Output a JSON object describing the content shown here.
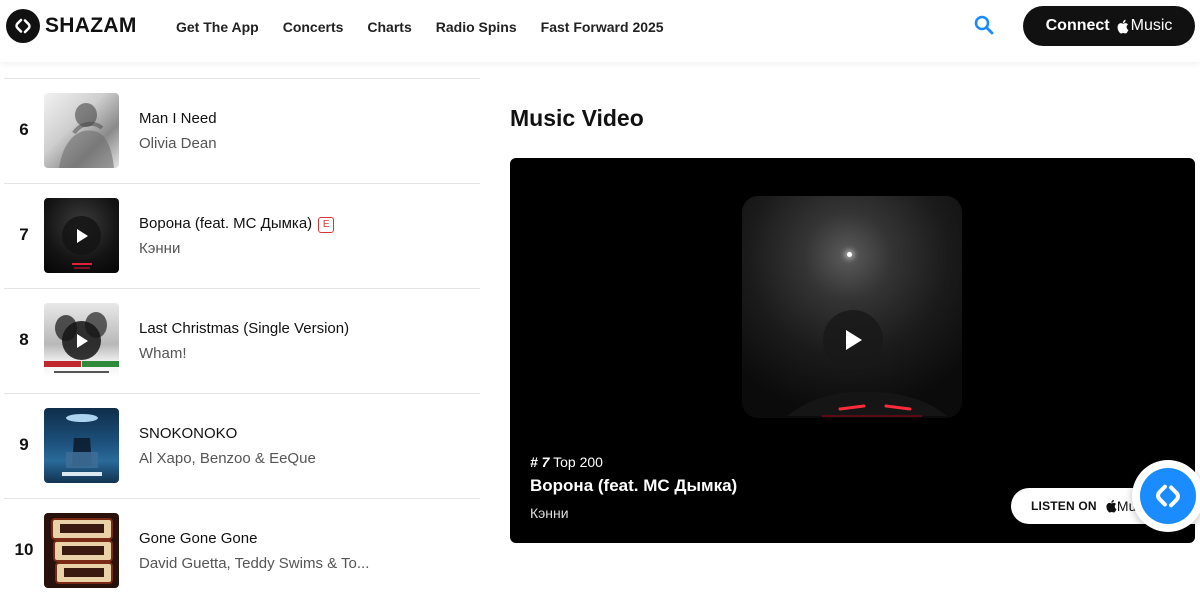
{
  "header": {
    "logo_text": "SHAZAM",
    "nav": [
      "Get The App",
      "Concerts",
      "Charts",
      "Radio Spins",
      "Fast Forward 2025"
    ],
    "connect_label": "Connect",
    "apple_music_label": "Music"
  },
  "chart_list": [
    {
      "rank": "6",
      "title": "Man I Need",
      "artist": "Olivia Dean",
      "explicit": false
    },
    {
      "rank": "7",
      "title": "Ворона (feat. MC Дымка)",
      "artist": "Кэнни",
      "explicit": true,
      "explicit_label": "E"
    },
    {
      "rank": "8",
      "title": "Last Christmas (Single Version)",
      "artist": "Wham!",
      "explicit": false
    },
    {
      "rank": "9",
      "title": "SNOKONOKO",
      "artist": "Al Xapo, Benzoo & EeQue",
      "explicit": false
    },
    {
      "rank": "10",
      "title": "Gone Gone Gone",
      "artist": "David Guetta, Teddy Swims & To...",
      "explicit": false
    }
  ],
  "music_video": {
    "heading": "Music Video",
    "rank_label": "# 7",
    "chart_label": "Top 200",
    "song": "Ворона (feat. MC Дымка)",
    "artist": "Кэнни",
    "listen_on_label": "LISTEN ON",
    "apple_music_label": "Mu"
  },
  "colors": {
    "accent_blue": "#1a8cff",
    "explicit_red": "#dd3333",
    "video_bg": "#000000"
  }
}
